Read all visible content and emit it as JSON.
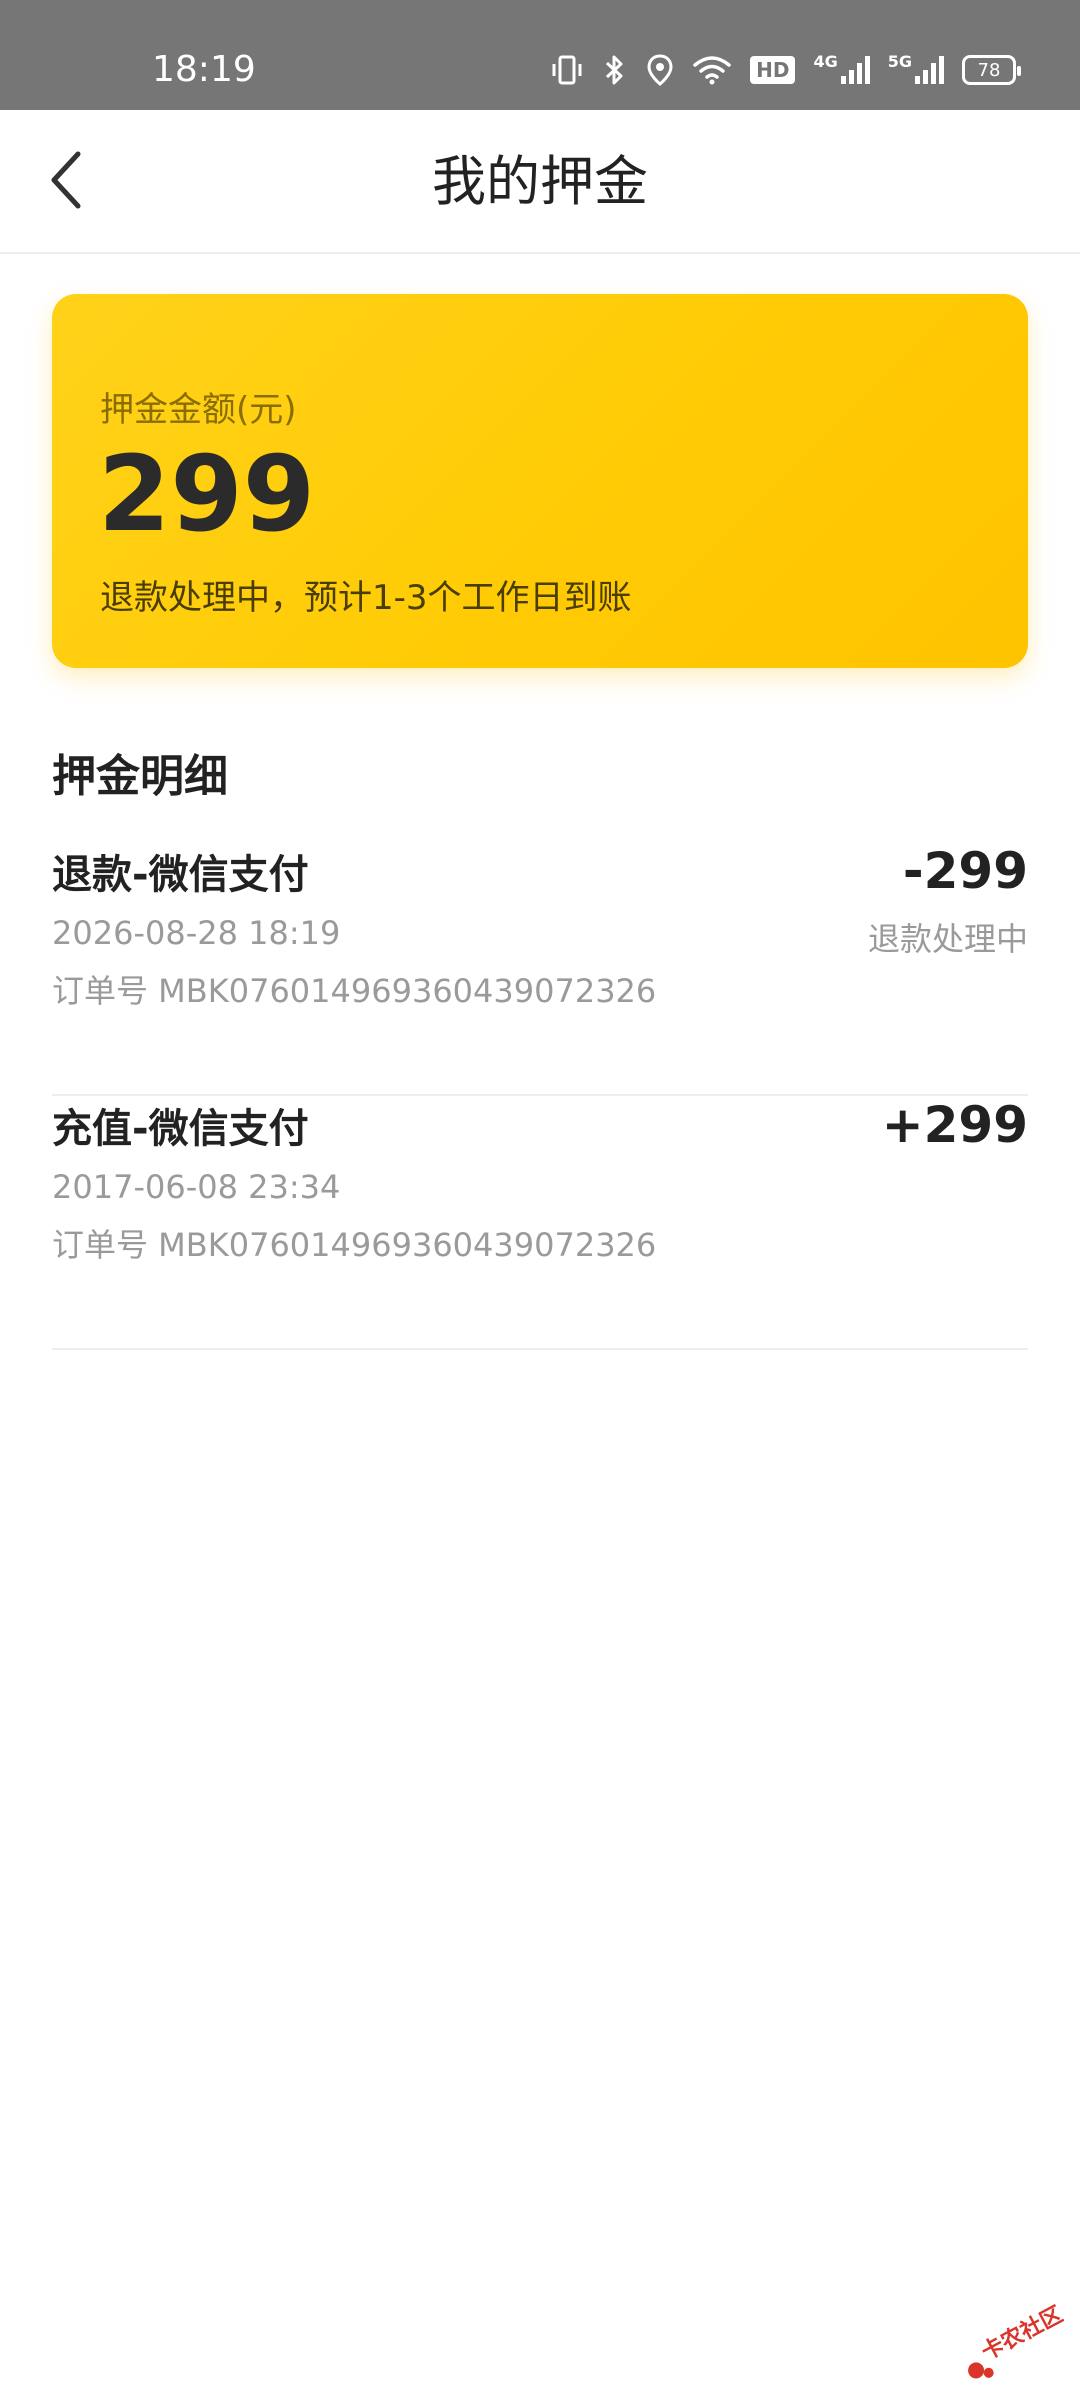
{
  "status_bar": {
    "time": "18:19",
    "hd_label": "HD",
    "net1_label": "4G",
    "net2_label": "5G",
    "battery": "78",
    "icons": [
      "vibrate-icon",
      "bluetooth-icon",
      "location-icon",
      "wifi-icon",
      "signal-icon",
      "battery-icon"
    ]
  },
  "header": {
    "title": "我的押金",
    "back_icon": "chevron-left-icon"
  },
  "deposit_card": {
    "label": "押金金额(元)",
    "amount": "299",
    "status": "退款处理中，预计1-3个工作日到账",
    "color": "#ffcb05"
  },
  "details": {
    "title": "押金明细",
    "records": [
      {
        "title": "退款-微信支付",
        "date": "2026-08-28 18:19",
        "order": "订单号 MBK07601496936043907​2326",
        "amount": "-299",
        "status": "退款处理中"
      },
      {
        "title": "充值-微信支付",
        "date": "2017-06-08 23:34",
        "order": "订单号 MBK076014969360439072326",
        "amount": "+299",
        "status": ""
      }
    ]
  },
  "watermark": {
    "text": "卡农社区"
  }
}
